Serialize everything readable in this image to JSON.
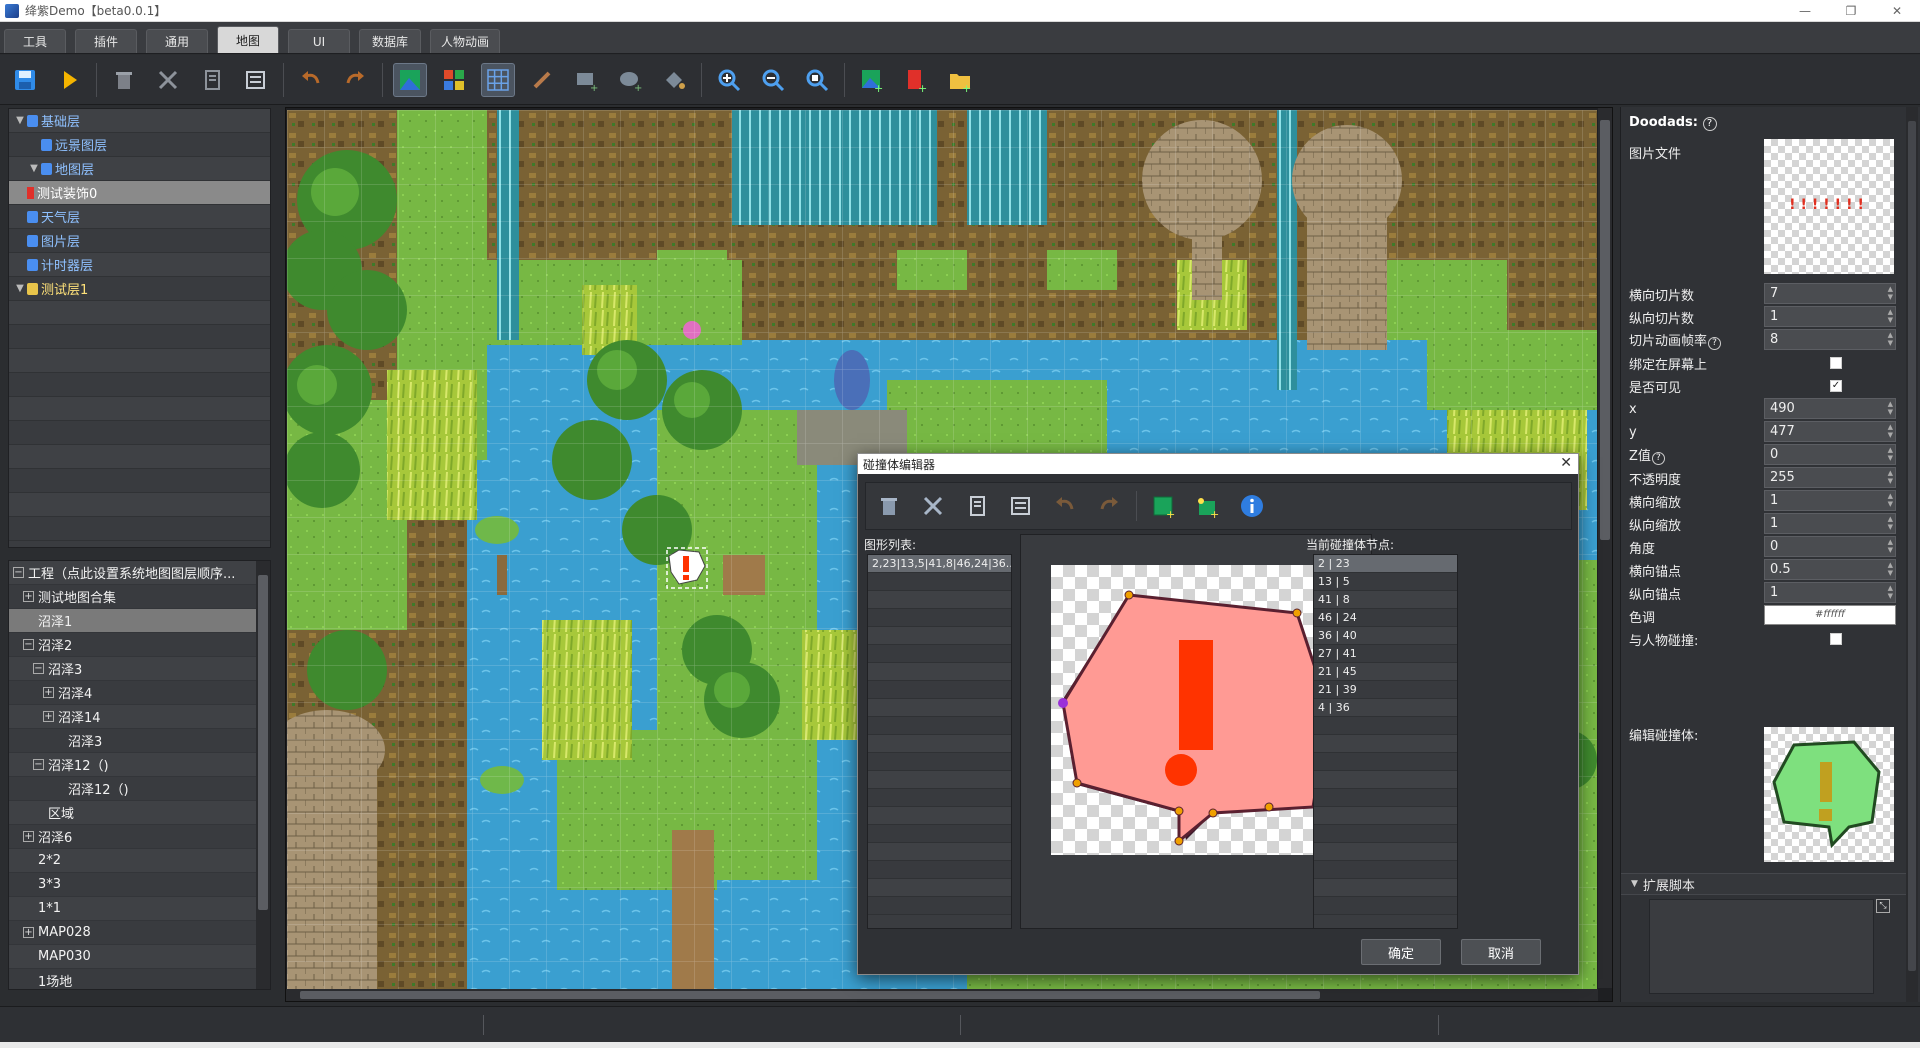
{
  "window": {
    "title": "绛紫Demo【beta0.0.1】",
    "minimize": "—",
    "restore": "❐",
    "close": "✕"
  },
  "tabs": [
    {
      "label": "工具"
    },
    {
      "label": "插件"
    },
    {
      "label": "通用"
    },
    {
      "label": "地图",
      "active": true
    },
    {
      "label": "UI"
    },
    {
      "label": "数据库"
    },
    {
      "label": "人物动画"
    }
  ],
  "toolbar": {
    "icons": [
      "save-icon",
      "play-icon",
      "delete-icon",
      "cut-icon",
      "copy-icon",
      "paste-icon",
      "undo-icon",
      "redo-icon",
      "map-layer-icon",
      "tile-number-icon",
      "grid-icon",
      "pencil-icon",
      "rect-icon",
      "ellipse-icon",
      "fill-icon",
      "zoom-in-icon",
      "zoom-out-icon",
      "zoom-fit-icon",
      "add-map-icon",
      "add-event-icon",
      "add-folder-icon"
    ]
  },
  "layers": [
    {
      "label": "基础层",
      "indent": 0,
      "expanded": true,
      "locked": true
    },
    {
      "label": "远景图层",
      "indent": 1,
      "locked": true
    },
    {
      "label": "地图层",
      "indent": 1,
      "expanded": true,
      "locked": true
    },
    {
      "label": "测试装饰0",
      "indent": 0,
      "selected": true,
      "marker": true
    },
    {
      "label": "天气层",
      "indent": 0,
      "locked": true
    },
    {
      "label": "图片层",
      "indent": 0,
      "locked": true
    },
    {
      "label": "计时器层",
      "indent": 0,
      "locked": true
    },
    {
      "label": "测试层1",
      "indent": 0,
      "expanded": true,
      "gold": true
    }
  ],
  "project_tree": [
    {
      "label": "工程（点此设置系统地图图层顺序...",
      "indent": 0,
      "sign": "−"
    },
    {
      "label": "测试地图合集",
      "indent": 1,
      "sign": "+"
    },
    {
      "label": "沼泽1",
      "indent": 1,
      "selected": true
    },
    {
      "label": "沼泽2",
      "indent": 1,
      "sign": "−"
    },
    {
      "label": "沼泽3",
      "indent": 2,
      "sign": "−"
    },
    {
      "label": "沼泽4",
      "indent": 3,
      "sign": "+"
    },
    {
      "label": "沼泽14",
      "indent": 3,
      "sign": "+"
    },
    {
      "label": "沼泽3",
      "indent": 4
    },
    {
      "label": "沼泽12（)",
      "indent": 2,
      "sign": "−"
    },
    {
      "label": "沼泽12（)",
      "indent": 4
    },
    {
      "label": "区域",
      "indent": 2
    },
    {
      "label": "沼泽6",
      "indent": 1,
      "sign": "+"
    },
    {
      "label": "2*2",
      "indent": 1
    },
    {
      "label": "3*3",
      "indent": 1
    },
    {
      "label": "1*1",
      "indent": 1
    },
    {
      "label": "MAP028",
      "indent": 1,
      "sign": "+"
    },
    {
      "label": "MAP030",
      "indent": 1
    },
    {
      "label": "1场地",
      "indent": 1
    }
  ],
  "props": {
    "title": "Doodads:",
    "help_icon": "?",
    "image_file_label": "图片文件",
    "image_file_sprites": "!!!!!!!",
    "rows": [
      {
        "label": "横向切片数",
        "value": "7",
        "type": "spin"
      },
      {
        "label": "纵向切片数",
        "value": "1",
        "type": "spin"
      },
      {
        "label": "切片动画帧率",
        "help": "?",
        "value": "8",
        "type": "spin"
      },
      {
        "label": "绑定在屏幕上",
        "value": "",
        "type": "check"
      },
      {
        "label": "是否可见",
        "value": "✓",
        "type": "check"
      },
      {
        "label": "x",
        "value": "490",
        "type": "spin"
      },
      {
        "label": "y",
        "value": "477",
        "type": "spin"
      },
      {
        "label": "Z值",
        "help": "?",
        "value": "0",
        "type": "spin"
      },
      {
        "label": "不透明度",
        "value": "255",
        "type": "spin"
      },
      {
        "label": "横向缩放",
        "value": "1",
        "type": "spin"
      },
      {
        "label": "纵向缩放",
        "value": "1",
        "type": "spin"
      },
      {
        "label": "角度",
        "value": "0",
        "type": "spin"
      },
      {
        "label": "横向锚点",
        "value": "0.5",
        "type": "spin"
      },
      {
        "label": "纵向锚点",
        "value": "1",
        "type": "spin"
      },
      {
        "label": "色调",
        "value": "#ffffff",
        "type": "color"
      },
      {
        "label": "与人物碰撞:",
        "value": "",
        "type": "check"
      }
    ],
    "edit_collision_label": "编辑碰撞体:",
    "script_section_label": "扩展脚本"
  },
  "dialog": {
    "title": "碰撞体编辑器",
    "close": "✕",
    "shape_list_label": "图形列表:",
    "shape_list": [
      "2,23|13,5|41,8|46,24|36..."
    ],
    "nodes_label": "当前碰撞体节点:",
    "nodes": [
      "2 | 23",
      "13 | 5",
      "41 | 8",
      "46 | 24",
      "36 | 40",
      "27 | 41",
      "21 | 45",
      "21 | 39",
      "4 | 36"
    ],
    "ok_label": "确定",
    "cancel_label": "取消",
    "toolbar_icons": [
      "delete-icon",
      "cut-icon",
      "copy-icon",
      "paste-icon",
      "undo-icon",
      "redo-icon",
      "add-shape-icon",
      "add-node-icon",
      "info-icon"
    ]
  },
  "colors": {
    "accent_blue": "#8fc1ff",
    "gold_layer": "#ffe27a",
    "collision_fill": "#ff9a94",
    "exclamation_red": "#ff3300",
    "collision_preview_green": "#7ee07e"
  }
}
